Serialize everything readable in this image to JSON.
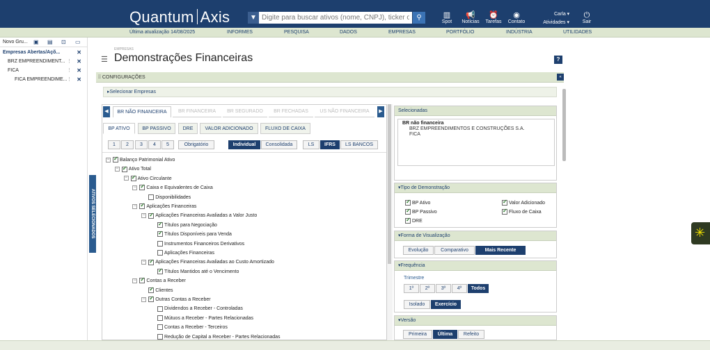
{
  "app": {
    "logo_left": "Quantum",
    "logo_right": "Axis",
    "search_placeholder": "Digite para buscar ativos (nome, CNPJ), ticker ou",
    "toolbar": [
      "Spot",
      "Notícias",
      "Tarefas",
      "Contato"
    ],
    "user_name": "Carla",
    "activities": "Atividades",
    "logout": "Sair"
  },
  "navbar": {
    "last_update": "Última atualização 14/08/2025",
    "items": [
      "INFORMES",
      "PESQUISA",
      "DADOS",
      "EMPRESAS",
      "PORTFÓLIO",
      "INDÚSTRIA",
      "UTILIDADES"
    ]
  },
  "left_panel": {
    "group_label": "Novo Gru...",
    "rows": [
      "Empresas Abertas/Açõ...",
      "BRZ EMPREENDIMENT...",
      "FICA",
      "FICA EMPREENDIME..."
    ],
    "vertical_tab": "ATIVOS SELECIONADOS"
  },
  "page": {
    "breadcrumb": "EMPRESAS",
    "title": "Demonstrações Financeiras",
    "help": "?",
    "config_label": "CONFIGURAÇÕES",
    "select_companies": "Selecionar Empresas"
  },
  "tabs": {
    "top": [
      "BR NÃO FINANCEIRA",
      "BR FINANCEIRA",
      "BR SEGURADO",
      "BR FECHADAS",
      "US NÃO FINANCEIRA"
    ],
    "sub": [
      "BP ATIVO",
      "BP PASSIVO",
      "DRE",
      "VALOR ADICIONADO",
      "FLUXO DE CAIXA"
    ],
    "numbers": [
      "1",
      "2",
      "3",
      "4",
      "5"
    ],
    "obrigatorio": "Obrigatório",
    "mode": [
      "Individual",
      "Consolidada"
    ],
    "standard": [
      "LS",
      "IFRS",
      "LS BANCOS"
    ]
  },
  "tree": [
    {
      "label": "Balanço Patrimonial Ativo",
      "level": 0,
      "tog": "−",
      "checked": true
    },
    {
      "label": "Ativo Total",
      "level": 1,
      "tog": "−",
      "checked": true
    },
    {
      "label": "Ativo Circulante",
      "level": 2,
      "tog": "−",
      "checked": true
    },
    {
      "label": "Caixa e Equivalentes de Caixa",
      "level": 3,
      "tog": "−",
      "checked": true
    },
    {
      "label": "Disponibilidades",
      "level": 4,
      "tog": "",
      "checked": false
    },
    {
      "label": "Aplicações Financeiras",
      "level": 3,
      "tog": "−",
      "checked": true
    },
    {
      "label": "Aplicações Financeiras Avaliadas a Valor Justo",
      "level": 4,
      "tog": "−",
      "checked": true
    },
    {
      "label": "Títulos para Negociação",
      "level": 5,
      "tog": "",
      "checked": true
    },
    {
      "label": "Títulos Disponíveis para Venda",
      "level": 5,
      "tog": "",
      "checked": true
    },
    {
      "label": "Instrumentos Financeiros Derivativos",
      "level": 5,
      "tog": "",
      "checked": false
    },
    {
      "label": "Aplicações Financeiras",
      "level": 5,
      "tog": "",
      "checked": false
    },
    {
      "label": "Aplicações Financeiras Avaliadas ao Custo Amortizado",
      "level": 4,
      "tog": "−",
      "checked": true
    },
    {
      "label": "Títulos Mantidos até o Vencimento",
      "level": 5,
      "tog": "",
      "checked": true
    },
    {
      "label": "Contas a Receber",
      "level": 3,
      "tog": "−",
      "checked": true
    },
    {
      "label": "Clientes",
      "level": 4,
      "tog": "",
      "checked": true
    },
    {
      "label": "Outras Contas a Receber",
      "level": 4,
      "tog": "−",
      "checked": true
    },
    {
      "label": "Dividendos a Receber - Controladas",
      "level": 5,
      "tog": "",
      "checked": false
    },
    {
      "label": "Mútuos a Receber - Partes Relacionadas",
      "level": 5,
      "tog": "",
      "checked": false
    },
    {
      "label": "Contas a Receber - Terceiros",
      "level": 5,
      "tog": "",
      "checked": false
    },
    {
      "label": "Redução de Capital a Receber - Partes Relacionadas",
      "level": 5,
      "tog": "",
      "checked": false
    }
  ],
  "selected": {
    "title": "Selecionadas",
    "group": "BR não financeira",
    "items": [
      "BRZ EMPREENDIMENTOS E CONSTRUÇÕES S.A.",
      "FICA"
    ]
  },
  "demo_type": {
    "title": "Tipo de Demonstração",
    "items": [
      "BP Ativo",
      "BP Passivo",
      "DRE",
      "Valor Adicionado",
      "Fluxo de Caixa"
    ]
  },
  "view_form": {
    "title": "Forma de Visualização",
    "options": [
      "Evolução",
      "Comparativo",
      "Mais Recente"
    ]
  },
  "frequency": {
    "title": "Frequência",
    "label": "Trimestre",
    "quarters": [
      "1º",
      "2º",
      "3º",
      "4º",
      "Todos"
    ],
    "mode": [
      "Isolado",
      "Exercício"
    ]
  },
  "version": {
    "title": "Versão",
    "options": [
      "Primeira",
      "Última",
      "Refeito"
    ]
  }
}
